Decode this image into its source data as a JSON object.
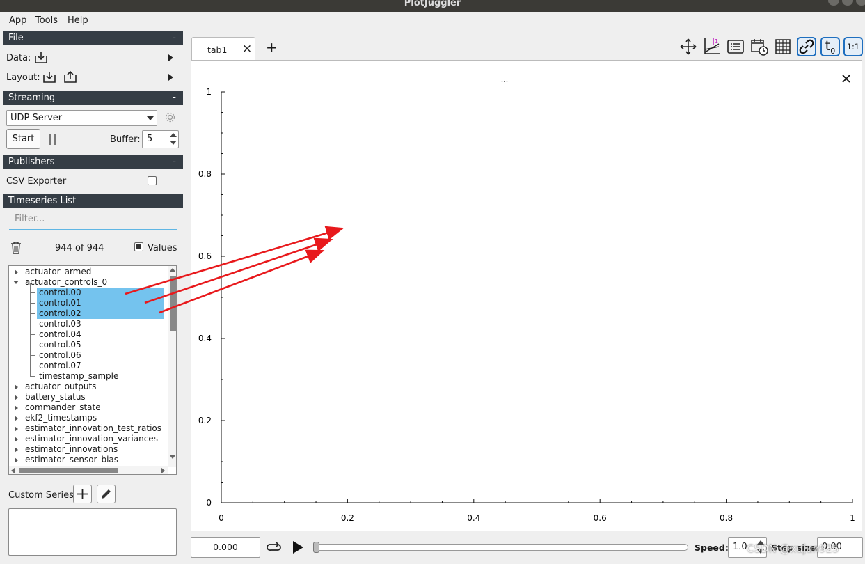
{
  "window": {
    "title": "PlotJuggler"
  },
  "menu": [
    "App",
    "Tools",
    "Help"
  ],
  "file_section": {
    "title": "File",
    "collapse": "-",
    "data_label": "Data:",
    "layout_label": "Layout:"
  },
  "streaming": {
    "title": "Streaming",
    "collapse": "-",
    "source": "UDP Server",
    "start_label": "Start",
    "buffer_label": "Buffer:",
    "buffer_value": "5"
  },
  "publishers": {
    "title": "Publishers",
    "collapse": "-",
    "csv_label": "CSV Exporter",
    "csv_checked": false
  },
  "timeseries": {
    "title": "Timeseries List",
    "filter_placeholder": "Filter...",
    "count": "944 of 944",
    "values_label": "Values",
    "tree": [
      {
        "label": "actuator_armed",
        "level": 0,
        "expander": "collapsed",
        "selected": false
      },
      {
        "label": "actuator_controls_0",
        "level": 0,
        "expander": "expanded",
        "selected": false
      },
      {
        "label": "control.00",
        "level": 1,
        "selected": true
      },
      {
        "label": "control.01",
        "level": 1,
        "selected": true
      },
      {
        "label": "control.02",
        "level": 1,
        "selected": true
      },
      {
        "label": "control.03",
        "level": 1,
        "selected": false
      },
      {
        "label": "control.04",
        "level": 1,
        "selected": false
      },
      {
        "label": "control.05",
        "level": 1,
        "selected": false
      },
      {
        "label": "control.06",
        "level": 1,
        "selected": false
      },
      {
        "label": "control.07",
        "level": 1,
        "selected": false
      },
      {
        "label": "timestamp_sample",
        "level": 1,
        "selected": false
      },
      {
        "label": "actuator_outputs",
        "level": 0,
        "expander": "collapsed",
        "selected": false
      },
      {
        "label": "battery_status",
        "level": 0,
        "expander": "collapsed",
        "selected": false
      },
      {
        "label": "commander_state",
        "level": 0,
        "expander": "collapsed",
        "selected": false
      },
      {
        "label": "ekf2_timestamps",
        "level": 0,
        "expander": "collapsed",
        "selected": false
      },
      {
        "label": "estimator_innovation_test_ratios",
        "level": 0,
        "expander": "collapsed",
        "selected": false
      },
      {
        "label": "estimator_innovation_variances",
        "level": 0,
        "expander": "collapsed",
        "selected": false
      },
      {
        "label": "estimator_innovations",
        "level": 0,
        "expander": "collapsed",
        "selected": false
      },
      {
        "label": "estimator_sensor_bias",
        "level": 0,
        "expander": "collapsed",
        "selected": false
      }
    ]
  },
  "custom_series": {
    "label": "Custom Series:"
  },
  "tabs": [
    {
      "label": "tab1",
      "close": "×"
    }
  ],
  "add_tab": "+",
  "toolbar_icons": [
    "move-icon",
    "ratio-icon",
    "legend-icon",
    "date-time-icon",
    "grid-icon",
    "link-icon",
    "time-zero-icon",
    "one-to-one-icon"
  ],
  "toolbar_text": {
    "t0": "t",
    "t0_sub": "0",
    "one_to_one": "1:1"
  },
  "plot": {
    "title": "...",
    "close": "×",
    "y_ticks": [
      "1",
      "0.8",
      "0.6",
      "0.4",
      "0.2",
      "0"
    ],
    "x_ticks": [
      "0",
      "0.2",
      "0.4",
      "0.6",
      "0.8",
      "1"
    ]
  },
  "chart_data": {
    "type": "line",
    "title": "...",
    "xlabel": "",
    "ylabel": "",
    "xlim": [
      0,
      1
    ],
    "ylim": [
      0,
      1
    ],
    "x_ticks": [
      0,
      0.2,
      0.4,
      0.6,
      0.8,
      1
    ],
    "y_ticks": [
      0,
      0.2,
      0.4,
      0.6,
      0.8,
      1
    ],
    "series": [],
    "grid": false
  },
  "annotation": {
    "description_color": "#e8191c"
  },
  "playback": {
    "time_value": "0.000",
    "speed_label": "Speed:",
    "speed_value": "1.0",
    "step_label": "Step size:",
    "step_value": "0.00",
    "progress": 0
  },
  "watermark": "CSDN @xujun925",
  "colors": {
    "header_bg": "#353d45",
    "selection": "#74c3ee",
    "accent": "#1f6fbf",
    "filter_line": "#5fb6e4"
  }
}
